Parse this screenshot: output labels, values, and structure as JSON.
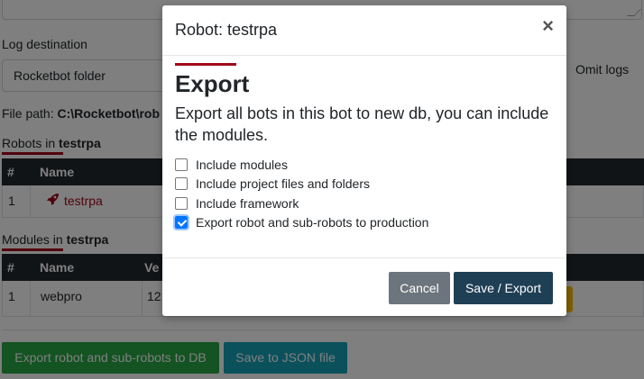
{
  "background": {
    "log_destination_label": "Log destination",
    "log_destination_value": "Rocketbot folder",
    "omit_logs_label": "Omit logs",
    "file_path_label": "File path:",
    "file_path_value": "C:\\Rocketbot\\rob",
    "robots_heading_prefix": "Robots in",
    "robots_heading_bot": "testrpa",
    "robots_table": {
      "headers": [
        "#",
        "Name"
      ],
      "rows": [
        {
          "num": "1",
          "name": "testrpa",
          "icon": "rocket-icon"
        }
      ]
    },
    "modules_heading_prefix": "Modules in",
    "modules_heading_bot": "testrpa",
    "modules_table": {
      "headers": [
        "#",
        "Name",
        "Ve"
      ],
      "rows": [
        {
          "num": "1",
          "name": "webpro",
          "version": "12."
        }
      ]
    },
    "buttons": {
      "export_db": "Export robot and sub-robots to DB",
      "save_json": "Save to JSON file"
    }
  },
  "modal": {
    "title": "Robot: testrpa",
    "close": "×",
    "heading": "Export",
    "description": "Export all bots in this bot to new db, you can include the modules.",
    "options": [
      {
        "label": "Include modules",
        "checked": false
      },
      {
        "label": "Include project files and folders",
        "checked": false
      },
      {
        "label": "Include framework",
        "checked": false
      },
      {
        "label": "Export robot and sub-robots to production",
        "checked": true
      }
    ],
    "cancel_label": "Cancel",
    "save_label": "Save / Export"
  },
  "colors": {
    "accent_red": "#a2061a",
    "table_header": "#23292f",
    "save_button": "#1f3f55",
    "cancel_button": "#6c757d",
    "export_db_button": "#28a745",
    "save_json_button": "#17a2b8"
  }
}
